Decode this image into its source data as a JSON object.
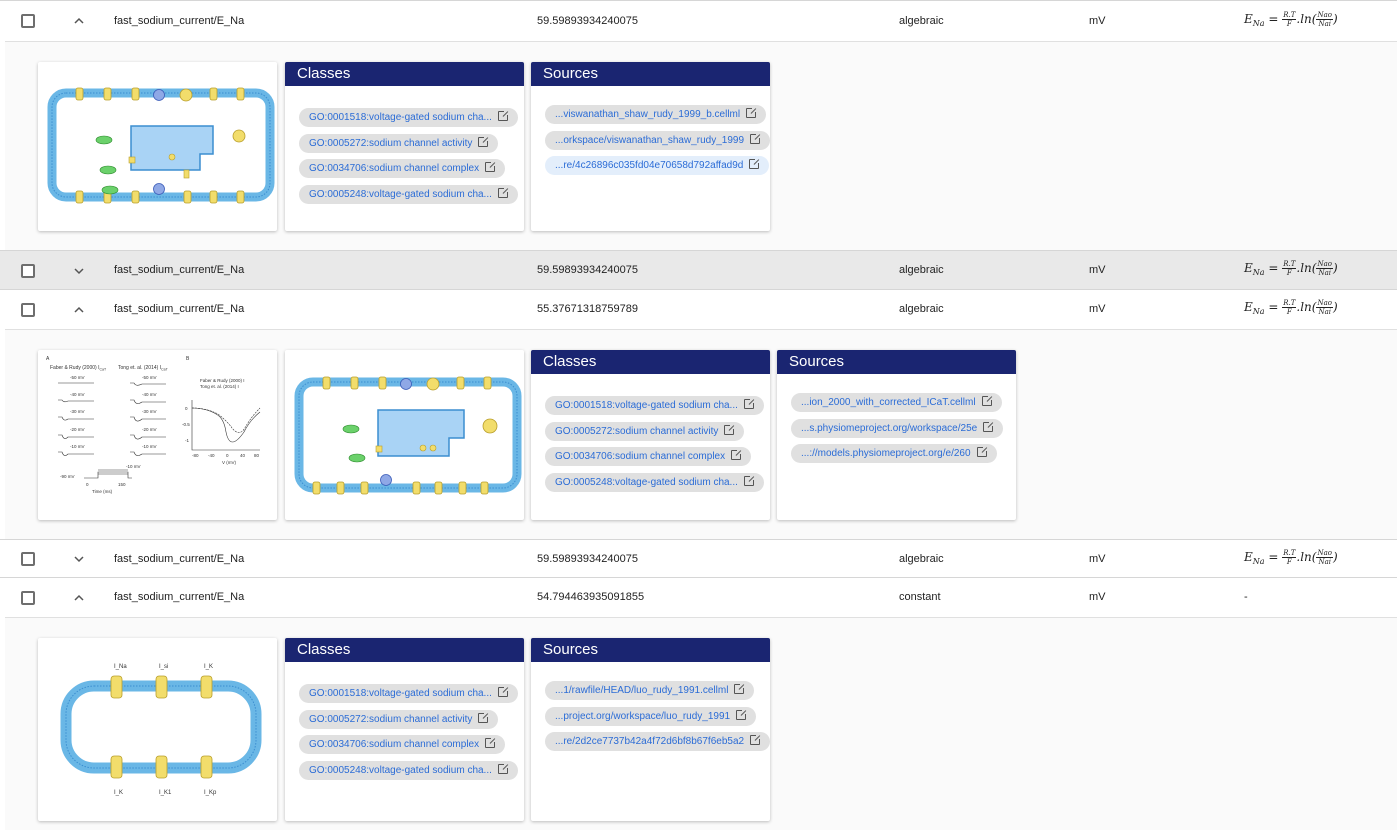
{
  "rows": [
    {
      "name": "fast_sodium_current/E_Na",
      "value": "59.59893934240075",
      "type": "algebraic",
      "unit": "mV",
      "eq": "E",
      "eq_sub": "Na",
      "eq_num1": "R.T",
      "eq_den1": "F",
      "eq_ln": ".ln",
      "eq_num2": "Nao",
      "eq_den2": "Nai",
      "expanded": true
    },
    {
      "name": "fast_sodium_current/E_Na",
      "value": "59.59893934240075",
      "type": "algebraic",
      "unit": "mV",
      "eq": "E",
      "eq_sub": "Na",
      "eq_num1": "R.T",
      "eq_den1": "F",
      "eq_ln": ".ln",
      "eq_num2": "Nao",
      "eq_den2": "Nai",
      "expanded": false
    },
    {
      "name": "fast_sodium_current/E_Na",
      "value": "55.37671318759789",
      "type": "algebraic",
      "unit": "mV",
      "eq": "E",
      "eq_sub": "Na",
      "eq_num1": "R.T",
      "eq_den1": "F",
      "eq_ln": ".ln",
      "eq_num2": "Nao",
      "eq_den2": "Nai",
      "expanded": true
    },
    {
      "name": "fast_sodium_current/E_Na",
      "value": "59.59893934240075",
      "type": "algebraic",
      "unit": "mV",
      "eq": "E",
      "eq_sub": "Na",
      "eq_num1": "R.T",
      "eq_den1": "F",
      "eq_ln": ".ln",
      "eq_num2": "Nao",
      "eq_den2": "Nai",
      "expanded": false
    },
    {
      "name": "fast_sodium_current/E_Na",
      "value": "54.794463935091855",
      "type": "constant",
      "unit": "mV",
      "eq_dash": "-",
      "expanded": true
    }
  ],
  "panels": [
    {
      "classes_title": "Classes",
      "sources_title": "Sources",
      "classes": [
        "GO:0001518:voltage-gated sodium cha...",
        "GO:0005272:sodium channel activity",
        "GO:0034706:sodium channel complex",
        "GO:0005248:voltage-gated sodium cha..."
      ],
      "sources": [
        "...viswanathan_shaw_rudy_1999_b.cellml",
        "...orkspace/viswanathan_shaw_rudy_1999",
        "...re/4c26896c035fd04e70658d792affad9d"
      ]
    },
    {
      "classes_title": "Classes",
      "sources_title": "Sources",
      "classes": [
        "GO:0001518:voltage-gated sodium cha...",
        "GO:0005272:sodium channel activity",
        "GO:0034706:sodium channel complex",
        "GO:0005248:voltage-gated sodium cha..."
      ],
      "sources": [
        "...ion_2000_with_corrected_ICaT.cellml",
        "...s.physiomeproject.org/workspace/25e",
        "...://models.physiomeproject.org/e/260"
      ],
      "figure": {
        "label_a": "A",
        "label_b": "B",
        "left_title_1": "Faber & Rudy (2000) I",
        "left_title_1_sub": "CaT",
        "left_title_2": "Tong et. al. (2014) I",
        "left_title_2_sub": "CaT",
        "mv_labels": [
          "-50 mV",
          "-40 mV",
          "-30 mV",
          "-20 mV",
          "-10 mV"
        ],
        "hold": "-90 mV",
        "step": "-10 mV",
        "t0": "0",
        "t1": "150",
        "time_label": "Time (ms)",
        "legend_1": "Faber & Rudy (2000) I",
        "legend_2": "Tong et. al. (2014) I",
        "y_ticks": [
          "0",
          "-0.5",
          "-1"
        ],
        "x_ticks": [
          "-80",
          "-40",
          "0",
          "40",
          "80"
        ],
        "x_label": "V (mV)",
        "y_label": "I_CaT (normalised)"
      }
    },
    {
      "classes_title": "Classes",
      "sources_title": "Sources",
      "classes": [
        "GO:0001518:voltage-gated sodium cha...",
        "GO:0005272:sodium channel activity",
        "GO:0034706:sodium channel complex",
        "GO:0005248:voltage-gated sodium cha..."
      ],
      "sources": [
        "...1/rawfile/HEAD/luo_rudy_1991.cellml",
        "...project.org/workspace/luo_rudy_1991",
        "...re/2d2ce7737b42a4f72d6bf8b67f6eb5a2"
      ],
      "figure": {
        "top_labels": [
          "I_Na",
          "I_si",
          "I_K"
        ],
        "bottom_labels": [
          "I_K",
          "I_K1",
          "I_Kp"
        ]
      }
    }
  ],
  "colors": {
    "header": "#1a2571",
    "chip": "#e0e0e0",
    "link": "#2b6cd6",
    "membrane": "#6ab7e6",
    "channel": "#f2dd6b"
  }
}
